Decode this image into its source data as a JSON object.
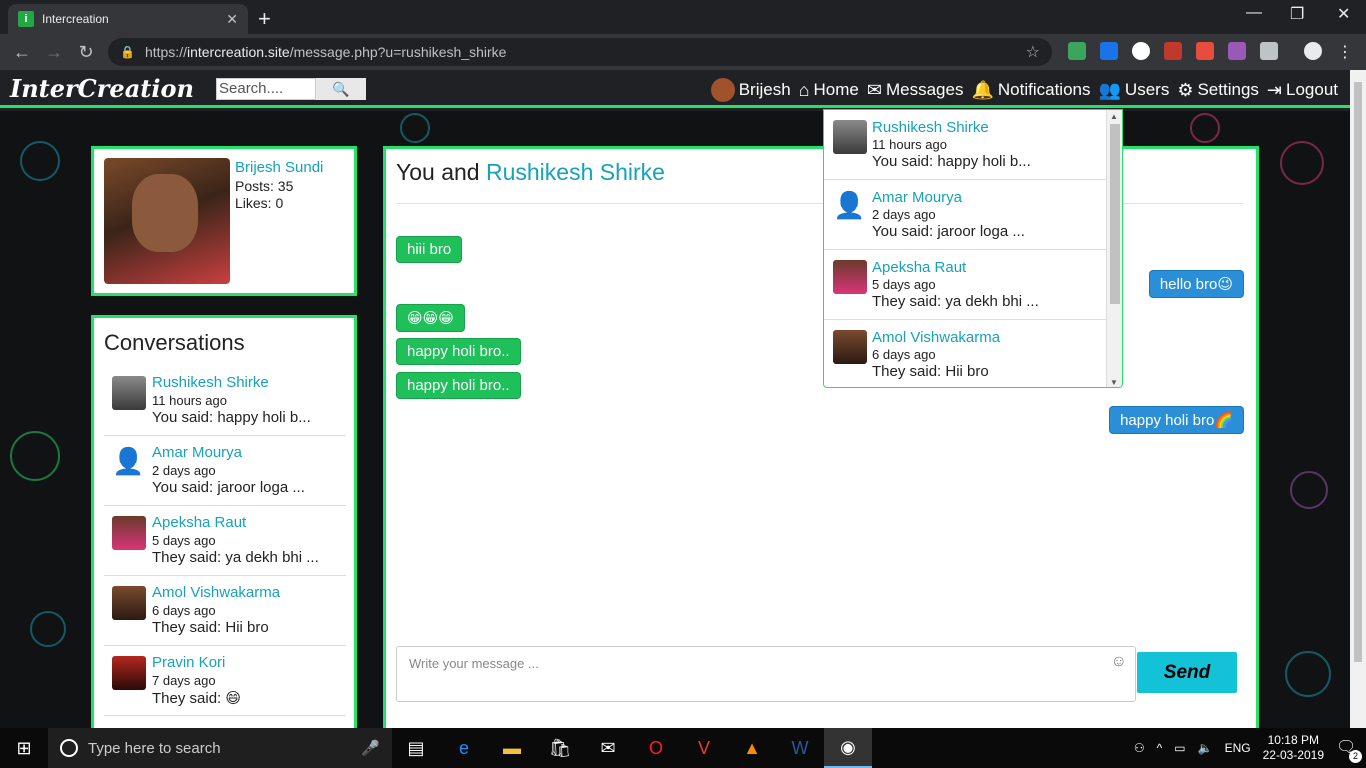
{
  "browser": {
    "tab_title": "Intercreation",
    "favicon_letter": "i",
    "url_prefix": "https://",
    "url_host": "intercreation.site",
    "url_path": "/message.php?u=rushikesh_shirke"
  },
  "site": {
    "logo": "InterCreation",
    "search_placeholder": "Search....",
    "nav": {
      "user": "Brijesh",
      "home": "Home",
      "messages": "Messages",
      "notifications": "Notifications",
      "users": "Users",
      "settings": "Settings",
      "logout": "Logout"
    }
  },
  "profile": {
    "name": "Brijesh Sundi",
    "posts": "Posts: 35",
    "likes": "Likes: 0"
  },
  "conversations": {
    "title": "Conversations",
    "items": [
      {
        "name": "Rushikesh Shirke",
        "time": "11 hours ago",
        "msg": "You said: happy holi b..."
      },
      {
        "name": "Amar Mourya",
        "time": "2 days ago",
        "msg": "You said: jaroor loga ..."
      },
      {
        "name": "Apeksha Raut",
        "time": "5 days ago",
        "msg": "They said: ya dekh bhi ..."
      },
      {
        "name": "Amol Vishwakarma",
        "time": "6 days ago",
        "msg": "They said: Hii bro"
      },
      {
        "name": "Pravin Kori",
        "time": "7 days ago",
        "msg": "They said: 😄"
      }
    ]
  },
  "chat": {
    "header_prefix": "You and",
    "partner": "Rushikesh Shirke",
    "messages": [
      {
        "dir": "in",
        "text": "hiii bro"
      },
      {
        "dir": "out",
        "text": "hello bro😉"
      },
      {
        "dir": "in",
        "text": "😁😁😁"
      },
      {
        "dir": "in",
        "text": "happy holi bro.."
      },
      {
        "dir": "in",
        "text": "happy holi bro.."
      },
      {
        "dir": "out",
        "text": "happy holi bro🌈"
      }
    ],
    "compose_placeholder": "Write your message ...",
    "send_label": "Send"
  },
  "dropdown": {
    "items": [
      {
        "name": "Rushikesh Shirke",
        "time": "11 hours ago",
        "msg": "You said: happy holi b..."
      },
      {
        "name": "Amar Mourya",
        "time": "2 days ago",
        "msg": "You said: jaroor loga ..."
      },
      {
        "name": "Apeksha Raut",
        "time": "5 days ago",
        "msg": "They said: ya dekh bhi ..."
      },
      {
        "name": "Amol Vishwakarma",
        "time": "6 days ago",
        "msg": "They said: Hii bro"
      }
    ]
  },
  "taskbar": {
    "search_placeholder": "Type here to search",
    "language": "ENG",
    "time": "10:18 PM",
    "date": "22-03-2019",
    "notification_count": "2"
  },
  "colors": {
    "accent_green": "#23e26a",
    "link_teal": "#17a2b8",
    "bubble_in": "#1fbf5a",
    "bubble_out": "#2a8fd6",
    "send_button": "#13c2d6"
  }
}
